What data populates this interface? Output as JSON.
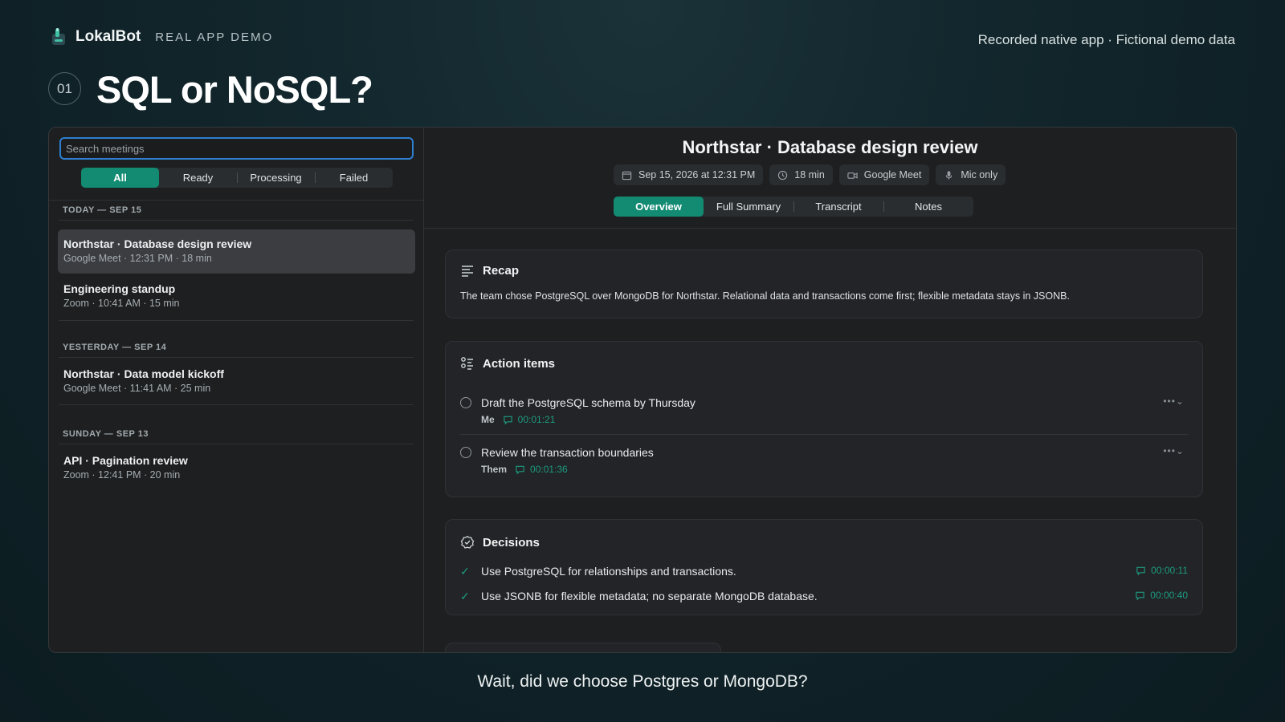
{
  "brand": {
    "name": "LokalBot",
    "tag": "REAL APP DEMO"
  },
  "top_note": "Recorded native app · Fictional demo data",
  "step_number": "01",
  "headline": "SQL or NoSQL?",
  "caption": "Wait, did we choose Postgres or MongoDB?",
  "sidebar": {
    "search_placeholder": "Search meetings",
    "filters": [
      "All",
      "Ready",
      "Processing",
      "Failed"
    ],
    "groups": [
      {
        "heading": "TODAY — SEP 15"
      },
      {
        "heading": "YESTERDAY — SEP 14"
      },
      {
        "heading": "SUNDAY — SEP 13"
      }
    ],
    "meetings": [
      {
        "title": "Northstar · Database design review",
        "meta": "Google Meet · 12:31 PM · 18 min"
      },
      {
        "title": "Engineering standup",
        "meta": "Zoom · 10:41 AM · 15 min"
      },
      {
        "title": "Northstar · Data model kickoff",
        "meta": "Google Meet · 11:41 AM · 25 min"
      },
      {
        "title": "API · Pagination review",
        "meta": "Zoom · 12:41 PM · 20 min"
      }
    ]
  },
  "meeting": {
    "title": "Northstar · Database design review",
    "date": "Sep 15, 2026 at 12:31 PM",
    "duration": "18 min",
    "platform": "Google Meet",
    "audio": "Mic only",
    "tabs": [
      "Overview",
      "Full Summary",
      "Transcript",
      "Notes"
    ]
  },
  "recap": {
    "heading": "Recap",
    "text": "The team chose PostgreSQL over MongoDB for Northstar. Relational data and transactions come first; flexible metadata stays in JSONB."
  },
  "action_items": {
    "heading": "Action items",
    "items": [
      {
        "text": "Draft the PostgreSQL schema by Thursday",
        "owner": "Me",
        "time": "00:01:21"
      },
      {
        "text": "Review the transaction boundaries",
        "owner": "Them",
        "time": "00:01:36"
      }
    ]
  },
  "decisions": {
    "heading": "Decisions",
    "items": [
      {
        "text": "Use PostgreSQL for relationships and transactions.",
        "time": "00:00:11"
      },
      {
        "text": "Use JSONB for flexible metadata; no separate MongoDB database.",
        "time": "00:00:40"
      }
    ]
  },
  "colors": {
    "accent": "#138a72",
    "accent_text": "#1d9b80",
    "focus": "#2e7fd0"
  },
  "icons": [
    "lokalbot-logo-icon",
    "calendar-icon",
    "clock-icon",
    "video-icon",
    "mic-icon",
    "recap-lines-icon",
    "action-list-icon",
    "decisions-badge-icon",
    "comment-icon",
    "more-icon",
    "check-icon"
  ]
}
